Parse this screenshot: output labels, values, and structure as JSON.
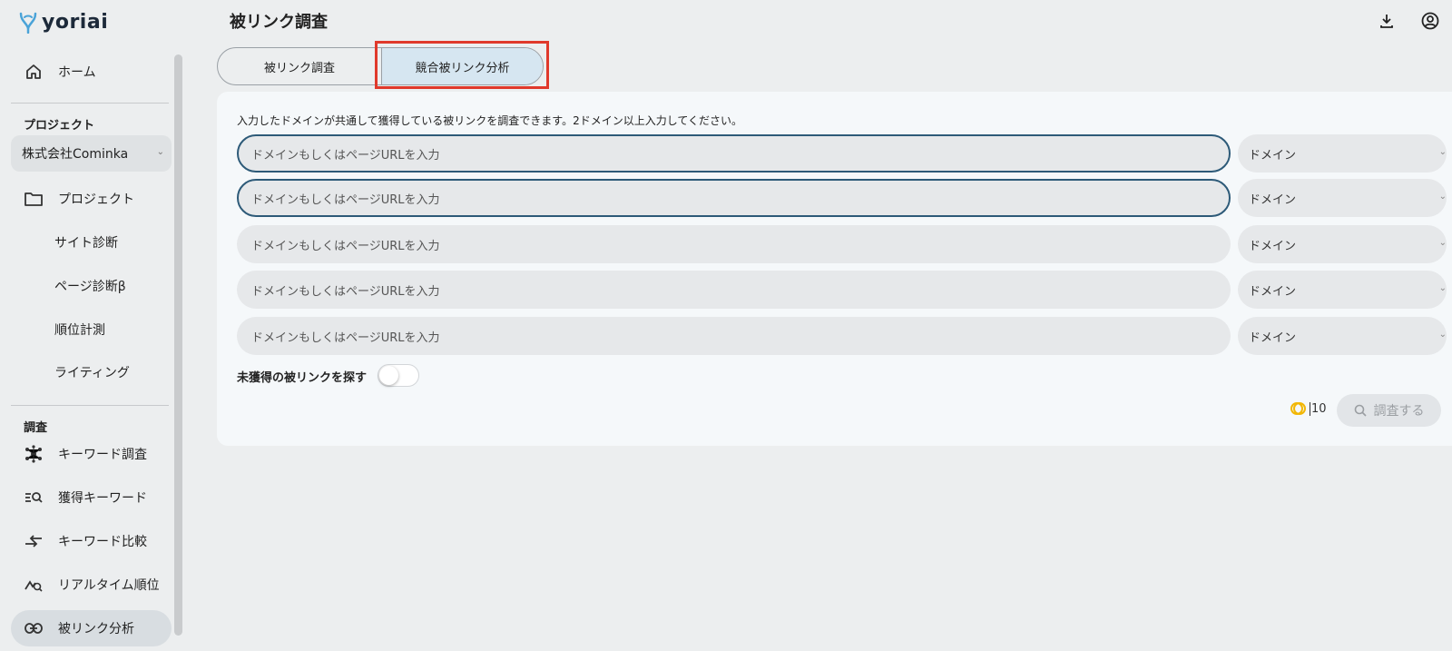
{
  "brand": {
    "name": "yoriai"
  },
  "header": {
    "title": "被リンク調査"
  },
  "sidebar": {
    "home": "ホーム",
    "project_section": "プロジェクト",
    "project_select": "株式会社Cominka",
    "project": "プロジェクト",
    "site_diag": "サイト診断",
    "page_diag": "ページ診断β",
    "rank": "順位計測",
    "writing": "ライティング",
    "research_section": "調査",
    "keyword_research": "キーワード調査",
    "acquired_keywords": "獲得キーワード",
    "keyword_compare": "キーワード比較",
    "realtime_rank": "リアルタイム順位",
    "backlink": "被リンク分析"
  },
  "tabs": {
    "tab1": "被リンク調査",
    "tab2": "競合被リンク分析"
  },
  "panel": {
    "description": "入力したドメインが共通して獲得している被リンクを調査できます。2ドメイン以上入力してください。",
    "rows": [
      {
        "placeholder": "ドメインもしくはページURLを入力",
        "select": "ドメイン"
      },
      {
        "placeholder": "ドメインもしくはページURLを入力",
        "select": "ドメイン"
      },
      {
        "placeholder": "ドメインもしくはページURLを入力",
        "select": "ドメイン"
      },
      {
        "placeholder": "ドメインもしくはページURLを入力",
        "select": "ドメイン"
      },
      {
        "placeholder": "ドメインもしくはページURLを入力",
        "select": "ドメイン"
      }
    ],
    "toggle_label": "未獲得の被リンクを探す",
    "credit": "10",
    "search_button": "調査する"
  },
  "colors": {
    "accent": "#2d5a78",
    "highlight": "#e0392b",
    "active_tab": "#d6e6f1",
    "coin": "#f2b705"
  }
}
